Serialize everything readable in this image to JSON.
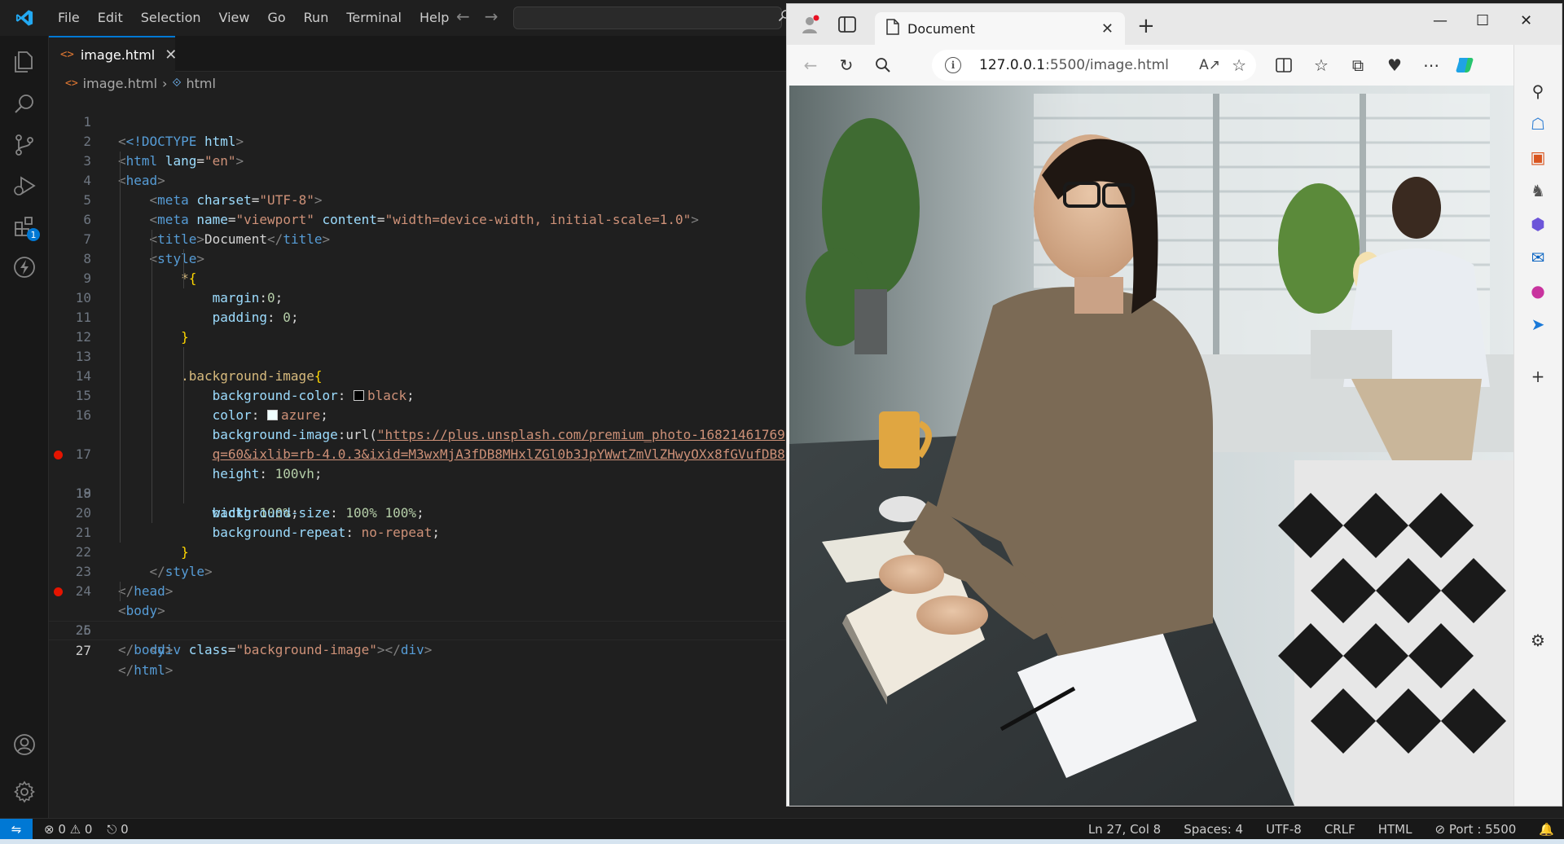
{
  "vscode": {
    "menu": [
      "File",
      "Edit",
      "Selection",
      "View",
      "Go",
      "Run",
      "Terminal",
      "Help"
    ],
    "tab": {
      "filename": "image.html"
    },
    "breadcrumb": {
      "file": "image.html",
      "symbol": "html"
    },
    "extensions_badge": "1",
    "code": {
      "l1_doctype": "<!DOCTYPE",
      "l1_html": "html",
      "html_lang_value": "\"en\"",
      "meta_charset_value": "\"UTF-8\"",
      "meta_name_value": "\"viewport\"",
      "meta_content_value": "\"width=device-width, initial-scale=1.0\"",
      "title_text": "Document",
      "selector_all": "*",
      "prop_margin": "margin",
      "val_margin": "0",
      "prop_padding": "padding",
      "val_padding": "0",
      "selector_bg": ".background-image",
      "prop_bgcolor": "background-color",
      "val_bgcolor": "black",
      "prop_color": "color",
      "val_color": "azure",
      "prop_bgimage": "background-image",
      "url_fn": "url",
      "url_line1": "\"https://plus.unsplash.com/premium_photo-16821461769",
      "url_line2": "q=60&ixlib=rb-4.0.3&ixid=M3wxMjA3fDB8MHxlZGl0b3JpYWwtZmVlZHwyOXx8fGVufDB8",
      "prop_height": "height",
      "val_height_num": "100",
      "val_height_unit": "vh",
      "prop_width": "width",
      "val_width": "100%",
      "prop_bgsize": "background-size",
      "val_bgsize": "100% 100%",
      "prop_bgrepeat": "background-repeat",
      "val_bgrepeat": "no-repeat",
      "div_class_value": "\"background-image\""
    },
    "statusbar": {
      "errors": "0",
      "warnings": "0",
      "ports": "0",
      "position": "Ln 27, Col 8",
      "spaces": "Spaces: 4",
      "encoding": "UTF-8",
      "eol": "CRLF",
      "language": "HTML",
      "port": "Port : 5500"
    }
  },
  "browser": {
    "tab_title": "Document",
    "url_host": "127.0.0.1",
    "url_rest": ":5500/image.html",
    "read_aloud": "A",
    "viewport_colors": {
      "background": "#000000"
    }
  },
  "colors": {
    "accent": "#0078d4",
    "breakpoint": "#e51400"
  }
}
